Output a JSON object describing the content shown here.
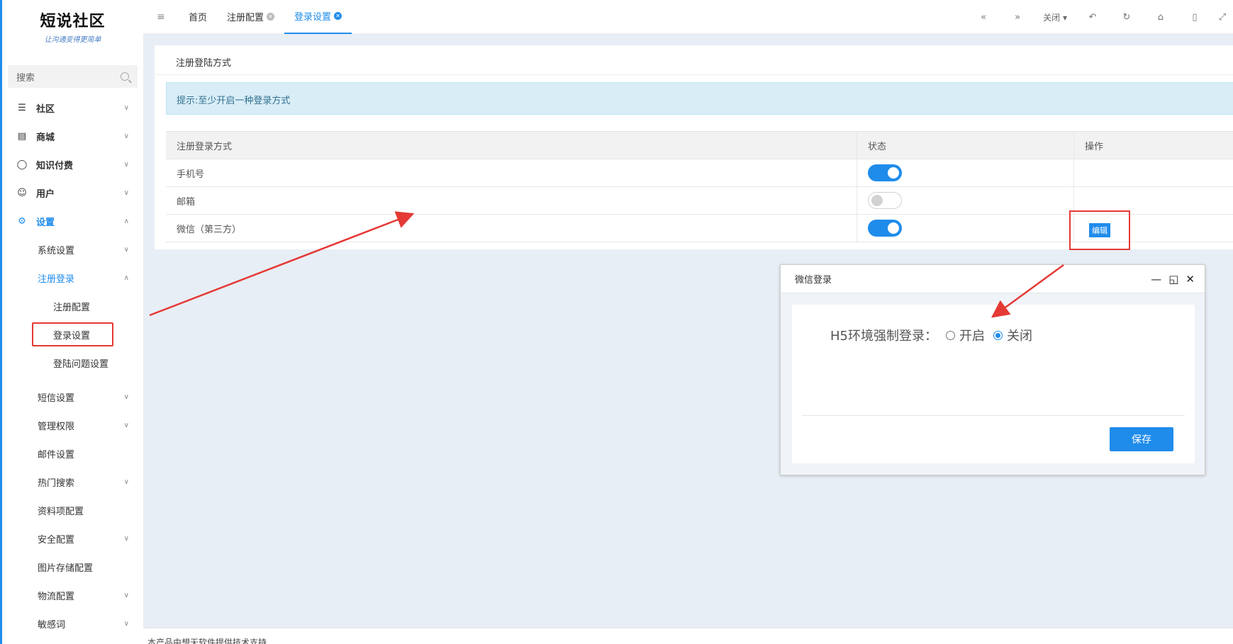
{
  "brand": {
    "title": "短说社区",
    "subtitle": "让沟通变得更简单"
  },
  "sidebar": {
    "search_placeholder": "搜索",
    "menu": [
      {
        "label": "社区",
        "icon": "chat-icon"
      },
      {
        "label": "商城",
        "icon": "store-icon"
      },
      {
        "label": "知识付费",
        "icon": "bulb-icon"
      },
      {
        "label": "用户",
        "icon": "user-icon"
      },
      {
        "label": "设置",
        "icon": "gear-icon"
      }
    ],
    "settings_sub": [
      "系统设置",
      "注册登录",
      "注册配置",
      "登录设置",
      "登陆问题设置",
      "短信设置",
      "管理权限",
      "邮件设置",
      "热门搜索",
      "资料项配置",
      "安全配置",
      "图片存储配置",
      "物流配置",
      "敏感词"
    ]
  },
  "topbar": {
    "tabs": [
      "首页",
      "注册配置",
      "登录设置"
    ],
    "close_label": "关闭"
  },
  "main": {
    "card_title": "注册登陆方式",
    "tip": "提示:至少开启一种登录方式",
    "table": {
      "headers": [
        "注册登录方式",
        "状态",
        "操作"
      ],
      "rows": [
        {
          "name": "手机号",
          "enabled": true
        },
        {
          "name": "邮箱",
          "enabled": false
        },
        {
          "name": "微信（第三方）",
          "enabled": true,
          "action": "编辑"
        }
      ]
    }
  },
  "modal": {
    "title": "微信登录",
    "field_label": "H5环境强制登录：",
    "option_on": "开启",
    "option_off": "关闭",
    "selected": "关闭",
    "save_label": "保存"
  },
  "footer": {
    "text": "本产品由想天软件提供技术支持"
  },
  "colors": {
    "accent": "#1f8ceb",
    "annotation": "#e53935"
  }
}
